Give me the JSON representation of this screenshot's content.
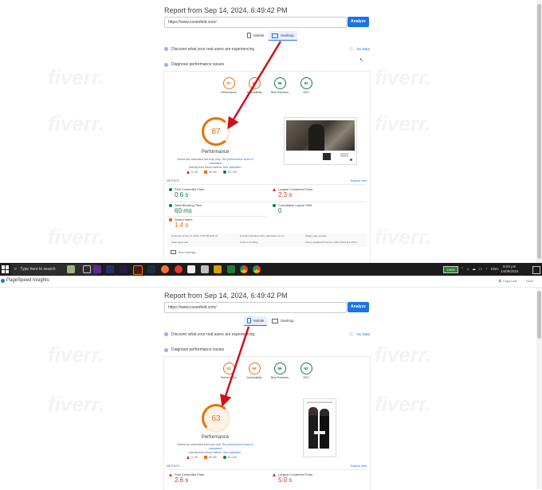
{
  "top": {
    "report_title": "Report from Sep 14, 2024, 6:49:42 PM",
    "url_value": "https://www.cosenfeld.com/",
    "analyze_label": "Analyze",
    "tabs": [
      {
        "label": "Mobile"
      },
      {
        "label": "Desktop"
      }
    ],
    "active_tab": "Desktop",
    "discover_text": "Discover what your real users are experiencing",
    "no_data_label": "No Data",
    "diagnose_text": "Diagnose performance issues",
    "categories": [
      {
        "score": "87",
        "label": "Performance",
        "color": "#e8710a"
      },
      {
        "score": "69",
        "label": "Accessibility",
        "color": "#e8710a"
      },
      {
        "score": "96",
        "label": "Best Practices",
        "color": "#0c7d3e"
      },
      {
        "score": "92",
        "label": "SEO",
        "color": "#0c7d3e"
      }
    ],
    "performance_score": "87",
    "performance_label": "Performance",
    "note_line1_a": "Values are estimated and may vary. The",
    "note_line1_link": "performance score is calculated",
    "note_line2_a": "directly from these metrics.",
    "note_line2_link": "See calculator.",
    "legend": [
      "0–49",
      "50–89",
      "90–100"
    ],
    "metrics_label": "METRICS",
    "expand_label": "Expand view",
    "metrics": [
      {
        "label": "First Contentful Paint",
        "value": "0.6 s",
        "status": "green"
      },
      {
        "label": "Largest Contentful Paint",
        "value": "2.3 s",
        "status": "red"
      },
      {
        "label": "Total Blocking Time",
        "value": "60 ms",
        "status": "green"
      },
      {
        "label": "Cumulative Layout Shift",
        "value": "0",
        "status": "green"
      },
      {
        "label": "Speed Index",
        "value": "1.4 s",
        "status": "orange"
      }
    ],
    "footer_items": [
      "Captured at Sep 14, 2024, 6:49 PM GMT+5",
      "Emulated Desktop with Lighthouse 12.2.0",
      "Single page session",
      "Initial page load",
      "Custom throttling",
      "Using HeadlessChromium 128.0.6613.113 with lr"
    ],
    "view_treemap": "View Treemap"
  },
  "taskbar": {
    "search_placeholder": "Type here to search",
    "battery": "100%",
    "language": "ENG",
    "time": "8:03 pm",
    "date": "14/09/2024"
  },
  "browser": {
    "app_title": "PageSpeed Insights",
    "copy_link": "Copy Link",
    "docs": "Docs"
  },
  "bottom": {
    "report_title": "Report from Sep 14, 2024, 6:49:42 PM",
    "url_value": "https://www.cosenfeld.com/",
    "analyze_label": "Analyze",
    "tabs": [
      {
        "label": "Mobile"
      },
      {
        "label": "Desktop"
      }
    ],
    "active_tab": "Mobile",
    "discover_text": "Discover what your real users are experiencing",
    "no_data_label": "No Data",
    "diagnose_text": "Diagnose performance issues",
    "categories": [
      {
        "score": "63",
        "label": "Performance",
        "color": "#e8710a"
      },
      {
        "score": "69",
        "label": "Accessibility",
        "color": "#e8710a"
      },
      {
        "score": "96",
        "label": "Best Practices",
        "color": "#0c7d3e"
      },
      {
        "score": "92",
        "label": "SEO",
        "color": "#0c7d3e"
      }
    ],
    "performance_score": "63",
    "performance_label": "Performance",
    "note_line1_a": "Values are estimated and may vary. The",
    "note_line1_link": "performance score is calculated",
    "note_line2_a": "directly from these metrics.",
    "note_line2_link": "See calculator.",
    "legend": [
      "0–49",
      "50–89",
      "90–100"
    ],
    "metrics_label": "METRICS",
    "expand_label": "Expand view",
    "metrics": [
      {
        "label": "First Contentful Paint",
        "value": "2.6 s",
        "status": "red"
      },
      {
        "label": "Largest Contentful Paint",
        "value": "5.0 s",
        "status": "red"
      }
    ]
  },
  "watermark_text": "fiverr.",
  "colors": {
    "accent": "#1a73e8",
    "arrow": "#d0101b",
    "orange": "#e8710a",
    "green": "#0c7d3e",
    "red": "#d93025"
  }
}
